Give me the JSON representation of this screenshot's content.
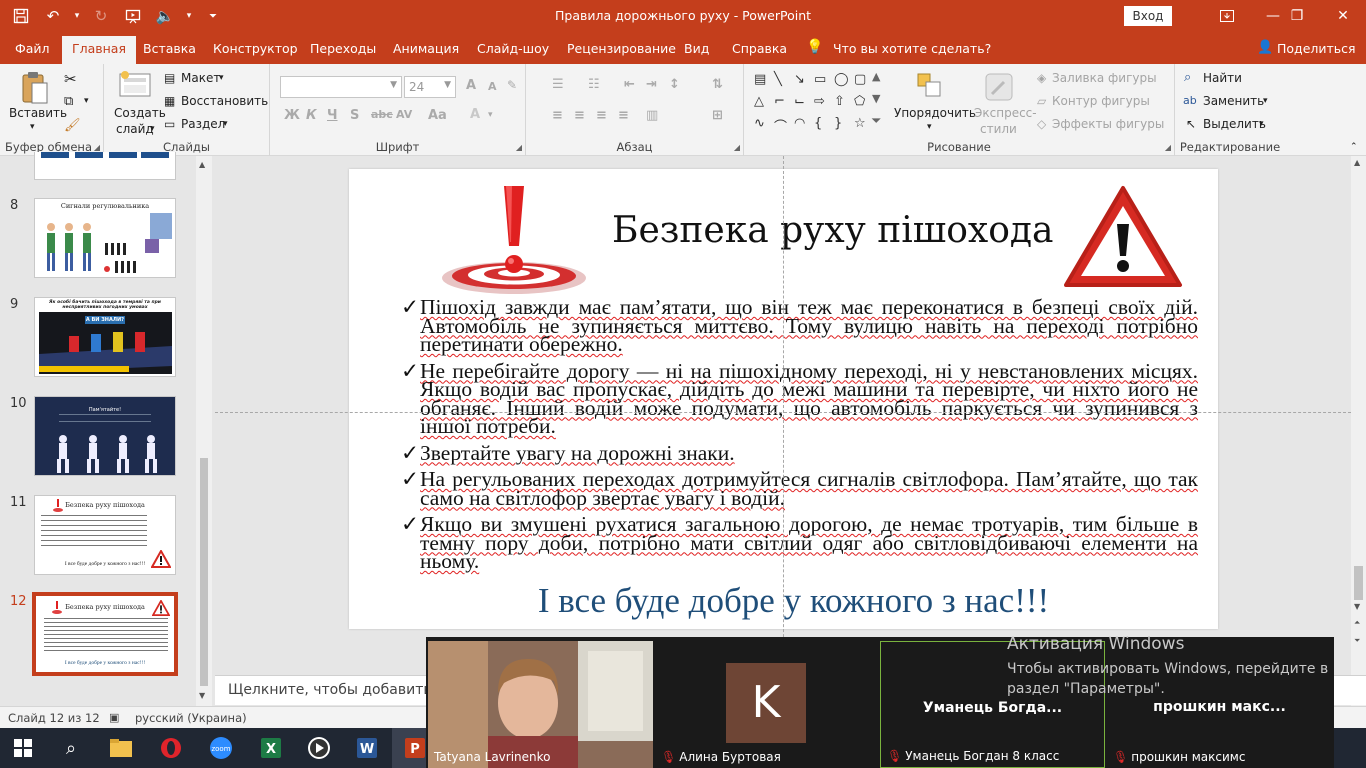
{
  "window": {
    "title": "Правила дорожнього руху  -  PowerPoint",
    "signin": "Вход"
  },
  "menu": {
    "tabs": [
      "Файл",
      "Главная",
      "Вставка",
      "Конструктор",
      "Переходы",
      "Анимация",
      "Слайд-шоу",
      "Рецензирование",
      "Вид",
      "Справка"
    ],
    "tell_me": "Что вы хотите сделать?",
    "share": "Поделиться"
  },
  "ribbon": {
    "clipboard": {
      "paste": "Вставить",
      "label": "Буфер обмена"
    },
    "slides": {
      "new_slide_1": "Создать",
      "new_slide_2": "слайд",
      "layout": "Макет",
      "reset": "Восстановить",
      "section": "Раздел",
      "label": "Слайды"
    },
    "font": {
      "size": "24",
      "label": "Шрифт",
      "bold": "Ж",
      "italic": "К",
      "underline": "Ч",
      "strike": "S",
      "spacing": "AV",
      "case": "Aa"
    },
    "paragraph": {
      "label": "Абзац"
    },
    "drawing": {
      "arrange_1": "Упорядочить",
      "styles_1": "Экспресс-",
      "styles_2": "стили",
      "fill": "Заливка фигуры",
      "outline": "Контур фигуры",
      "effects": "Эффекты фигуры",
      "label": "Рисование"
    },
    "editing": {
      "find": "Найти",
      "replace": "Заменить",
      "select": "Выделить",
      "label": "Редактирование"
    }
  },
  "thumbnails": [
    {
      "num": "8",
      "title": "Сигнали регулювальника"
    },
    {
      "num": "9",
      "title": "Як особі бачить пішохода в темряві та при несприятливих погодних умовах",
      "subtitle": "А ВИ ЗНАЛИ?"
    },
    {
      "num": "10",
      "title": "Пам'ятайте!"
    },
    {
      "num": "11",
      "title": "Безпека руху пішохода",
      "footer": "І все буде добре у кожного з нас!!!"
    },
    {
      "num": "12",
      "title": "Безпека руху пішохода",
      "footer": "І все буде добре у кожного з нас!!!"
    }
  ],
  "slide": {
    "title": "Безпека руху пішохода",
    "bullets": [
      "Пішохід завжди має пам’ятати, що він теж має переконатися в безпеці своїх дій. Автомобіль не зупиняється миттєво. Тому вулицю навіть на переході потрібно перетинати обережно.",
      "Не перебігайте дорогу — ні на пішохідному переході, ні у невстановлених місцях. Якщо водій вас пропускає, дійдіть до межі машини та перевірте, чи ніхто його не обганяє. Інший водій може подумати, що автомобіль паркується чи зупинився з іншої потреби.",
      "Звертайте увагу на дорожні знаки.",
      "На регульованих переходах дотримуйтеся сигналів світлофора. Пам’ятайте, що так само на світлофор звертає увагу і водій.",
      "Якщо ви змушені рухатися загальною дорогою, де немає тротуарів, тим більше в темну пору доби, потрібно мати світлий одяг або світловідбиваючі елементи на ньому."
    ],
    "closing": "І все буде добре у кожного з нас!!!"
  },
  "notes": {
    "placeholder": "Щелкните, чтобы добавить за"
  },
  "status": {
    "slide_info": "Слайд 12 из 12",
    "language": "русский (Украина)"
  },
  "video": {
    "participants": [
      {
        "name": "Tatyana Lavrinenko"
      },
      {
        "name": "Алина Буртовая",
        "initial": "K"
      },
      {
        "name": "Уманець Богдан 8 класс",
        "center": "Уманець  Богда..."
      },
      {
        "name": "прошкин максимс",
        "center": "прошкин  макс..."
      }
    ]
  },
  "activation": {
    "line1": "Активация Windows",
    "line2": "Чтобы активировать Windows, перейдите в",
    "line3": "раздел \"Параметры\"."
  },
  "colors": {
    "brand": "#c43e1c",
    "closing_text": "#1f4e79",
    "warning_red": "#d62a22"
  }
}
